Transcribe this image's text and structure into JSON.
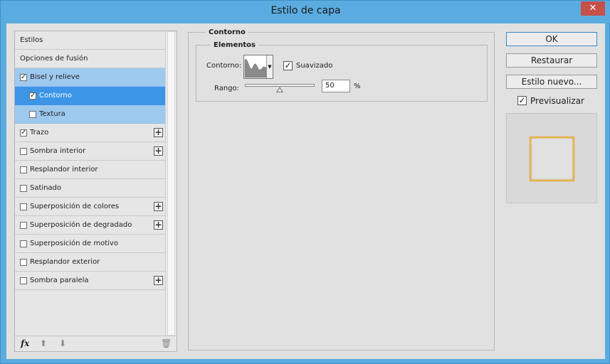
{
  "window": {
    "title": "Estilo de capa",
    "close_glyph": "✕"
  },
  "styles_list": {
    "header": "Estilos",
    "blending": "Opciones de fusión",
    "items": [
      {
        "label": "Bisel y relieve",
        "checked": true,
        "indent": false,
        "has_plus": false
      },
      {
        "label": "Contorno",
        "checked": true,
        "indent": true,
        "has_plus": false
      },
      {
        "label": "Textura",
        "checked": false,
        "indent": true,
        "has_plus": false
      },
      {
        "label": "Trazo",
        "checked": true,
        "indent": false,
        "has_plus": true
      },
      {
        "label": "Sombra interior",
        "checked": false,
        "indent": false,
        "has_plus": true
      },
      {
        "label": "Resplandor interior",
        "checked": false,
        "indent": false,
        "has_plus": false
      },
      {
        "label": "Satinado",
        "checked": false,
        "indent": false,
        "has_plus": false
      },
      {
        "label": "Superposición de colores",
        "checked": false,
        "indent": false,
        "has_plus": true
      },
      {
        "label": "Superposición de degradado",
        "checked": false,
        "indent": false,
        "has_plus": true
      },
      {
        "label": "Superposición de motivo",
        "checked": false,
        "indent": false,
        "has_plus": false
      },
      {
        "label": "Resplandor exterior",
        "checked": false,
        "indent": false,
        "has_plus": false
      },
      {
        "label": "Sombra paralela",
        "checked": false,
        "indent": false,
        "has_plus": true
      }
    ],
    "footer": {
      "fx_label": "fx",
      "up_icon": "arrow-up-icon",
      "down_icon": "arrow-down-icon",
      "trash_icon": "trash-icon"
    }
  },
  "contour_panel": {
    "group_title": "Contorno",
    "elements_title": "Elementos",
    "contour_label": "Contorno:",
    "smoothing_label": "Suavizado",
    "smoothing_checked": true,
    "range_label": "Rango:",
    "range_value": "50",
    "range_unit": "%",
    "range_fraction": 0.5
  },
  "buttons": {
    "ok": "OK",
    "reset": "Restaurar",
    "new_style": "Estilo nuevo...",
    "preview_label": "Previsualizar",
    "preview_checked": true
  },
  "colors": {
    "title_bar": "#5aace0",
    "selected_light": "#9ec9ef",
    "selected_dark": "#3d95e8",
    "preview_stroke": "#e6b34a"
  }
}
